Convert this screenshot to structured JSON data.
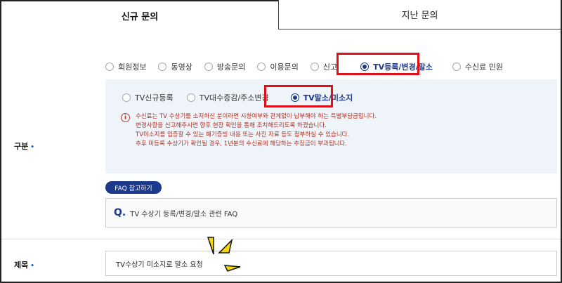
{
  "tabs": [
    {
      "label": "신규 문의",
      "active": true
    },
    {
      "label": "지난 문의",
      "active": false
    }
  ],
  "categories": {
    "label": "구분",
    "required_mark": "•",
    "options": [
      "회원정보",
      "동영상",
      "방송문의",
      "이용문의",
      "신고",
      "TV등록/변경/말소",
      "수신료 민원"
    ],
    "selected": "TV등록/변경/말소"
  },
  "sub_options": {
    "options": [
      "TV신규등록",
      "TV대수증감/주소변경",
      "TV말소/미소지"
    ],
    "selected": "TV말소/미소지"
  },
  "notice": {
    "icon": "info-icon",
    "lines": [
      "수신료는 TV 수상기를 소지하신 분이라면 시청여부와 관계없이 납부해야 하는 특별부담금입니다.",
      "변경사항을 신고해주시면 향후 현장 확인을 통해 조치해드리도록 하겠습니다.",
      "TV미소지를 입증할 수 있는 폐기증빙 내용 또는 사진 자료 등도 첨부하실 수 있습니다.",
      "추후 미등록 수상기가 확인될 경우, 1년분의 수신료에 해당하는 추징금이 부과됩니다."
    ]
  },
  "faq": {
    "button_label": "FAQ 참고하기",
    "q_mark": "Q.",
    "question": "TV 수상기 등록/변경/말소 관련 FAQ"
  },
  "title_field": {
    "label": "제목",
    "required_mark": "•",
    "value": "TV수상기 미소지로 말소 요청"
  },
  "colors": {
    "accent": "#1b3a8c",
    "highlight_box": "#e0101a",
    "notice_text": "#b03020",
    "panel_bg": "#eef4fa",
    "spark": "#f5d90a"
  }
}
